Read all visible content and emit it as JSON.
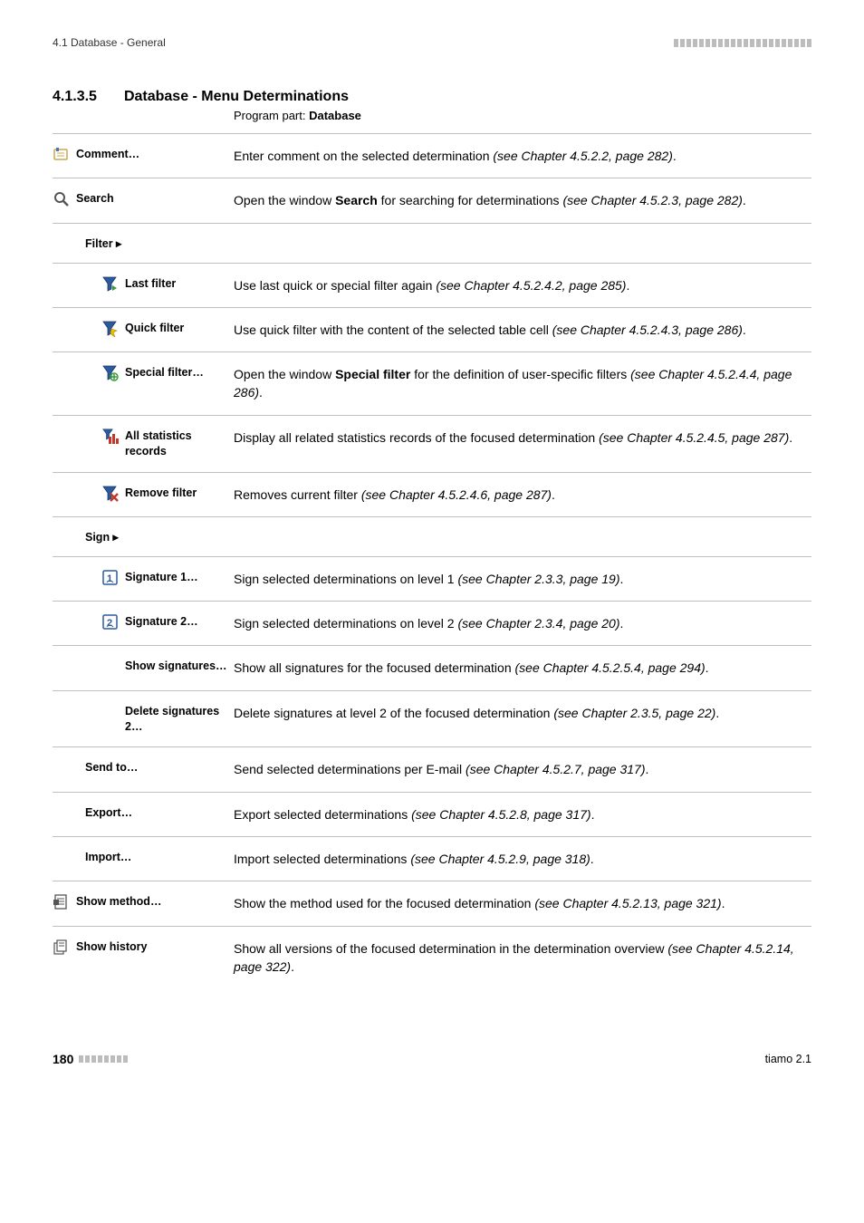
{
  "running_header": "4.1 Database - General",
  "section": {
    "number": "4.1.3.5",
    "title": "Database - Menu Determinations",
    "program_part_prefix": "Program part: ",
    "program_part": "Database"
  },
  "rows": [
    {
      "kind": "row",
      "indent": 0,
      "icon": "comment-icon",
      "label": "Comment…",
      "desc_pre": "Enter comment on the selected determination ",
      "desc_ital": "(see Chapter 4.5.2.2, page 282)",
      "desc_post": "."
    },
    {
      "kind": "row",
      "indent": 0,
      "icon": "search-icon",
      "label": "Search",
      "desc_pre": "Open the window ",
      "desc_bold": "Search",
      "desc_mid": " for searching for determinations ",
      "desc_ital": "(see Chapter 4.5.2.3, page 282)",
      "desc_post": "."
    },
    {
      "kind": "header",
      "label": "Filter ▸"
    },
    {
      "kind": "row",
      "indent": 2,
      "icon": "last-filter-icon",
      "label": "Last filter",
      "desc_pre": "Use last quick or special filter again ",
      "desc_ital": "(see Chapter 4.5.2.4.2, page 285)",
      "desc_post": "."
    },
    {
      "kind": "row",
      "indent": 2,
      "icon": "quick-filter-icon",
      "label": "Quick filter",
      "desc_pre": "Use quick filter with the content of the selected table cell ",
      "desc_ital": "(see Chapter 4.5.2.4.3, page 286)",
      "desc_post": "."
    },
    {
      "kind": "row",
      "indent": 2,
      "icon": "special-filter-icon",
      "label": "Special filter…",
      "desc_pre": "Open the window ",
      "desc_bold": "Special filter",
      "desc_mid": " for the definition of user-specific filters ",
      "desc_ital": "(see Chapter 4.5.2.4.4, page 286)",
      "desc_post": "."
    },
    {
      "kind": "row",
      "indent": 2,
      "icon": "all-statistics-icon",
      "label": "All statistics records",
      "desc_pre": "Display all related statistics records of the focused determination ",
      "desc_ital": "(see Chapter 4.5.2.4.5, page 287)",
      "desc_post": "."
    },
    {
      "kind": "row",
      "indent": 2,
      "icon": "remove-filter-icon",
      "label": "Remove filter",
      "desc_pre": "Removes current filter ",
      "desc_ital": "(see Chapter 4.5.2.4.6, page 287)",
      "desc_post": "."
    },
    {
      "kind": "header",
      "label": "Sign ▸"
    },
    {
      "kind": "row",
      "indent": 2,
      "icon": "signature-1-icon",
      "label": "Signature 1…",
      "desc_pre": "Sign selected determinations on level 1 ",
      "desc_ital": "(see Chapter 2.3.3, page 19)",
      "desc_post": "."
    },
    {
      "kind": "row",
      "indent": 2,
      "icon": "signature-2-icon",
      "label": "Signature 2…",
      "desc_pre": "Sign selected determinations on level 2 ",
      "desc_ital": "(see Chapter 2.3.4, page 20)",
      "desc_post": "."
    },
    {
      "kind": "row",
      "indent": 2,
      "icon": null,
      "label": "Show signatures…",
      "desc_pre": "Show all signatures for the focused determination ",
      "desc_ital": "(see Chapter 4.5.2.5.4, page 294)",
      "desc_post": "."
    },
    {
      "kind": "row",
      "indent": 2,
      "icon": null,
      "label": "Delete signatures 2…",
      "desc_pre": "Delete signatures at level 2 of the focused determination ",
      "desc_ital": "(see Chapter 2.3.5, page 22)",
      "desc_post": "."
    },
    {
      "kind": "row",
      "indent": 1,
      "icon": null,
      "label": "Send to…",
      "desc_pre": "Send selected determinations per E-mail ",
      "desc_ital": "(see Chapter 4.5.2.7, page 317)",
      "desc_post": "."
    },
    {
      "kind": "row",
      "indent": 1,
      "icon": null,
      "label": "Export…",
      "desc_pre": "Export selected determinations ",
      "desc_ital": "(see Chapter 4.5.2.8, page 317)",
      "desc_post": "."
    },
    {
      "kind": "row",
      "indent": 1,
      "icon": null,
      "label": "Import…",
      "desc_pre": "Import selected determinations ",
      "desc_ital": "(see Chapter 4.5.2.9, page 318)",
      "desc_post": "."
    },
    {
      "kind": "row",
      "indent": 0,
      "icon": "show-method-icon",
      "label": "Show method…",
      "desc_pre": "Show the method used for the focused determination ",
      "desc_ital": "(see Chapter 4.5.2.13, page 321)",
      "desc_post": "."
    },
    {
      "kind": "row",
      "indent": 0,
      "icon": "show-history-icon",
      "label": "Show history",
      "desc_pre": "Show all versions of the focused determination in the determination overview ",
      "desc_ital": "(see Chapter 4.5.2.14, page 322)",
      "desc_post": "."
    }
  ],
  "footer": {
    "page": "180",
    "product": "tiamo 2.1"
  }
}
